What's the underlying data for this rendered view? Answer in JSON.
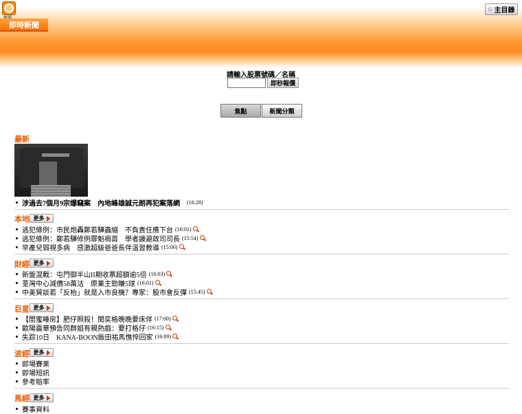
{
  "header": {
    "logo_text": "新聞",
    "home_label": "主目錄",
    "tab_label": "即時新聞"
  },
  "search": {
    "label": "請輸入股票號碼／名稱",
    "input_value": "",
    "button_label": "即秒報價"
  },
  "segments": {
    "focus": "焦點",
    "category": "新聞分類"
  },
  "more_label": "更多",
  "latest": {
    "title": "最新",
    "headline": "涉過去7個月9宗爆竊案　內地峰雄誠元朗再犯案落網",
    "time": "(16:28)"
  },
  "local": {
    "title": "本地",
    "items": [
      {
        "text": "逃犯條例：市民炮轟鄭若驊蟲縮　不負責任應下台",
        "time": "(16:01)"
      },
      {
        "text": "逃犯條例：鄭若驊修例罪魁禍首　學者譏避政司司長",
        "time": "(15:54)"
      },
      {
        "text": "早產兒弱視多病　感激超級爸爸長伴溫習教導",
        "time": "(15:00)"
      }
    ]
  },
  "finance": {
    "title": "財經",
    "items": [
      {
        "text": "新盤混戰：屯門御半山II期收票超額逾5倍",
        "time": "(16:03)"
      },
      {
        "text": "荃灣中心減價58萬沽　原業主勁賺5球",
        "time": "(16:01)"
      },
      {
        "text": "中美貿談若「反枱」就是入市良機？專家：股市會反彈",
        "time": "(15:45)"
      }
    ]
  },
  "stars": {
    "title": "巨星",
    "items": [
      {
        "text": "【閨蜜睡房】肥仔照殺！閏奕格晚晚要床伴",
        "time": "(17:00)"
      },
      {
        "text": "歐陽震華預告同群姐有親熱戲：要打格仔",
        "time": "(16:15)"
      },
      {
        "text": "失踪10日　KANA-BOON飯田祐馬憔悴回家",
        "time": "(16:09)"
      }
    ]
  },
  "soccer": {
    "title": "波經",
    "items": [
      "即場賽果",
      "即場短訊",
      "參考賠率"
    ]
  },
  "horse": {
    "title": "馬經",
    "items": [
      "賽事資料"
    ]
  }
}
